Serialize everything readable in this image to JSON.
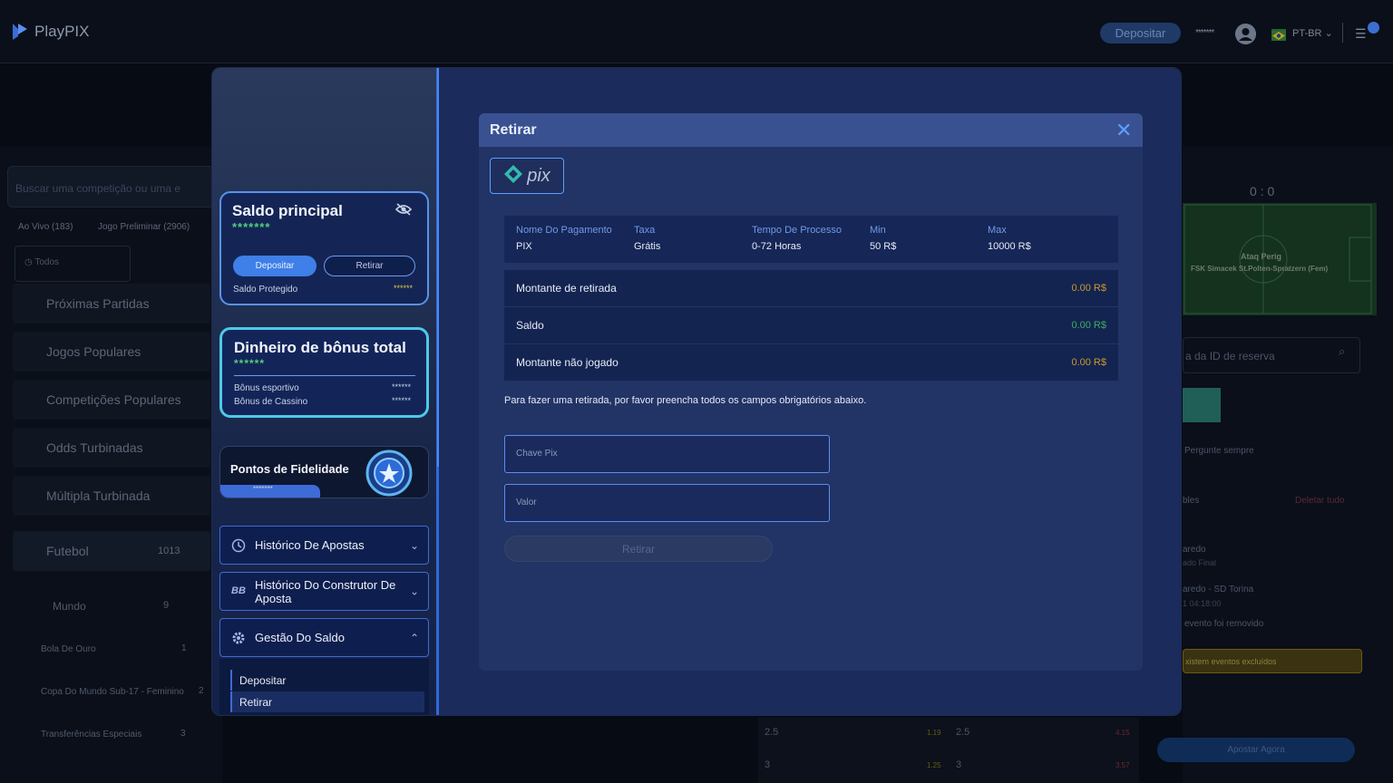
{
  "topbar": {
    "logo": "PlayPIX",
    "deposit_label": "Depositar",
    "balance_mask": "*******",
    "language": "PT-BR"
  },
  "background_left": {
    "search_placeholder": "Buscar uma competição ou uma e",
    "tab_live": "Ao Vivo (183)",
    "tab_prematch": "Jogo Preliminar (2906)",
    "filter_all": "Todos",
    "sections": [
      "Próximas Partidas",
      "Jogos Populares",
      "Competições Populares",
      "Odds Turbinadas",
      "Múltipla Turbinada"
    ],
    "sport": "Futebol",
    "sport_count": "1013",
    "region": "Mundo",
    "region_count": "9",
    "competitions": [
      {
        "name": "Bola De Ouro",
        "count": "1"
      },
      {
        "name": "Copa Do Mundo Sub-17 - Feminino",
        "count": "2"
      },
      {
        "name": "Transferências Especiais",
        "count": "3"
      }
    ]
  },
  "background_right": {
    "score": "0 : 0",
    "match_line1": "Ataq Perig",
    "match_line2": "FSK Simacek St.Polten-Spratzern (Fem)",
    "reservation_placeholder": "a da ID de reserva",
    "odds_setting": "Pergunte sempre",
    "betslip_label": "bles",
    "delete_all": "Deletar tudo",
    "event1": "aredo",
    "event1_sub": "ado Final",
    "event2": "aredo - SD Torina",
    "event2_sub": "1 04:18:00",
    "removed_note": "evento foi removido",
    "excluded_warning": "xistem eventos excluídos",
    "place_bet": "Apostar Agora",
    "odds": [
      {
        "line": "2.5",
        "value": "1.19",
        "line2": "2.5",
        "value2": "4.15"
      },
      {
        "line": "3",
        "value": "1.25",
        "line2": "3",
        "value2": "3.57"
      }
    ]
  },
  "modal": {
    "saldo": {
      "title": "Saldo principal",
      "mask": "*******",
      "deposit_label": "Depositar",
      "withdraw_label": "Retirar",
      "protected_label": "Saldo Protegido",
      "protected_mask": "******"
    },
    "bonus": {
      "title": "Dinheiro de bônus total",
      "mask": "******",
      "sport_label": "Bônus esportivo",
      "sport_mask": "******",
      "casino_label": "Bônus de Cassino",
      "casino_mask": "******"
    },
    "loyalty": {
      "title": "Pontos de Fidelidade",
      "mask": "*******"
    },
    "menu": [
      {
        "label": "Histórico De Apostas"
      },
      {
        "label": "Histórico Do Construtor De Aposta"
      },
      {
        "label": "Gestão Do Saldo"
      }
    ],
    "submenu": [
      "Depositar",
      "Retirar"
    ]
  },
  "withdraw": {
    "title": "Retirar",
    "pix_label": "pix",
    "info_headers": [
      "Nome Do Pagamento",
      "Taxa",
      "Tempo De Processo",
      "Min",
      "Max"
    ],
    "info_values": [
      "PIX",
      "Grátis",
      "0-72 Horas",
      "50 R$",
      "10000 R$"
    ],
    "rows": [
      {
        "label": "Montante de retirada",
        "value": "0.00 R$",
        "color": "#c99a2e"
      },
      {
        "label": "Saldo",
        "value": "0.00 R$",
        "color": "#3fae5a"
      },
      {
        "label": "Montante não jogado",
        "value": "0.00 R$",
        "color": "#c99a2e"
      }
    ],
    "note": "Para fazer uma retirada, por favor preencha todos os campos obrigatórios abaixo.",
    "pix_key_placeholder": "Chave Pix",
    "amount_placeholder": "Valor",
    "submit_label": "Retirar"
  }
}
